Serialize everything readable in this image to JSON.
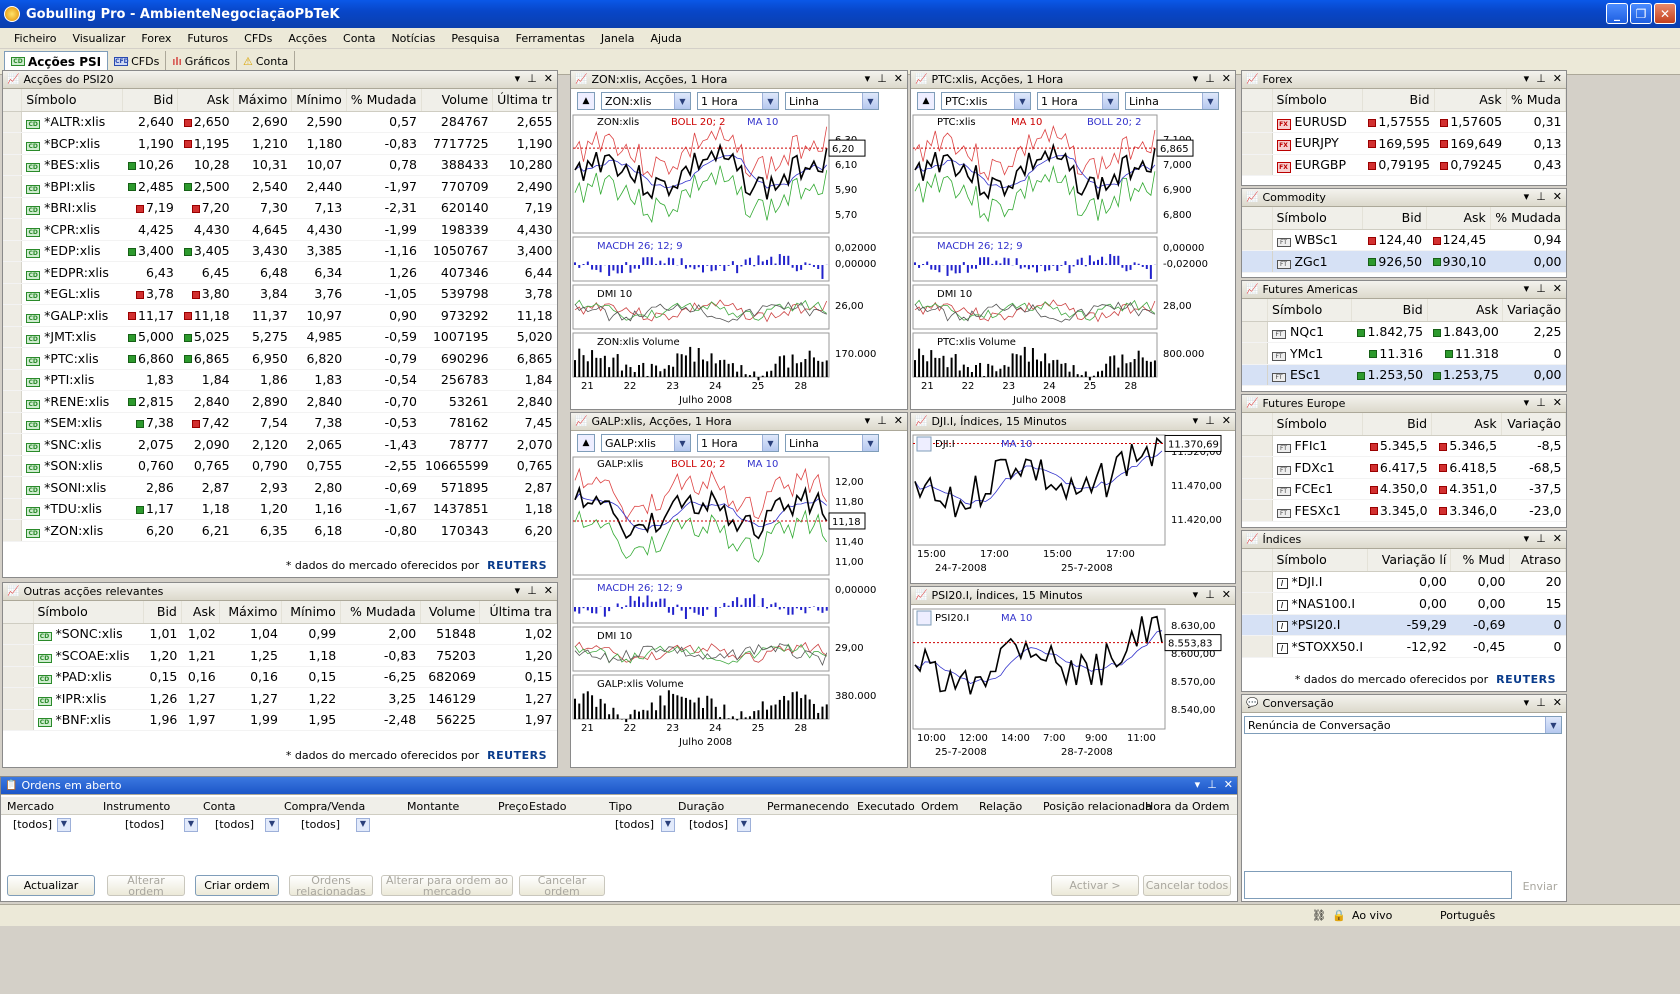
{
  "app": {
    "title": "Gobulling Pro - AmbienteNegociaçãoPbTeK"
  },
  "menu": [
    "Ficheiro",
    "Visualizar",
    "Forex",
    "Futuros",
    "CFDs",
    "Acções",
    "Conta",
    "Notícias",
    "Pesquisa",
    "Ferramentas",
    "Janela",
    "Ajuda"
  ],
  "toolbar": {
    "tabs": [
      "Acções PSI",
      "CFDs",
      "Gráficos",
      "Conta"
    ]
  },
  "psi20": {
    "title": "Acções do PSI20",
    "headers": [
      "Símbolo",
      "Bid",
      "Ask",
      "Máximo",
      "Mínimo",
      "% Mudada",
      "Volume",
      "Última tr"
    ],
    "rows": [
      [
        "*ALTR:xlis",
        "2,640",
        "2,650",
        "2,690",
        "2,590",
        "0,57",
        "284767",
        "2,655",
        "",
        "r"
      ],
      [
        "*BCP:xlis",
        "1,190",
        "1,195",
        "1,210",
        "1,180",
        "-0,83",
        "7717725",
        "1,190",
        "",
        "r"
      ],
      [
        "*BES:xlis",
        "10,26",
        "10,28",
        "10,31",
        "10,07",
        "0,78",
        "388433",
        "10,280",
        "g",
        ""
      ],
      [
        "*BPI:xlis",
        "2,485",
        "2,500",
        "2,540",
        "2,440",
        "-1,97",
        "770709",
        "2,490",
        "g",
        "g"
      ],
      [
        "*BRI:xlis",
        "7,19",
        "7,20",
        "7,30",
        "7,13",
        "-2,31",
        "620140",
        "7,19",
        "r",
        "r"
      ],
      [
        "*CPR:xlis",
        "4,425",
        "4,430",
        "4,645",
        "4,430",
        "-1,99",
        "198339",
        "4,430",
        "",
        ""
      ],
      [
        "*EDP:xlis",
        "3,400",
        "3,405",
        "3,430",
        "3,385",
        "-1,16",
        "1050767",
        "3,400",
        "g",
        "g"
      ],
      [
        "*EDPR:xlis",
        "6,43",
        "6,45",
        "6,48",
        "6,34",
        "1,26",
        "407346",
        "6,44",
        "",
        ""
      ],
      [
        "*EGL:xlis",
        "3,78",
        "3,80",
        "3,84",
        "3,76",
        "-1,05",
        "539798",
        "3,78",
        "r",
        "r"
      ],
      [
        "*GALP:xlis",
        "11,17",
        "11,18",
        "11,37",
        "10,97",
        "0,90",
        "973292",
        "11,18",
        "r",
        "r"
      ],
      [
        "*JMT:xlis",
        "5,000",
        "5,025",
        "5,275",
        "4,985",
        "-0,59",
        "1007195",
        "5,020",
        "g",
        "g"
      ],
      [
        "*PTC:xlis",
        "6,860",
        "6,865",
        "6,950",
        "6,820",
        "-0,79",
        "690296",
        "6,865",
        "g",
        "g"
      ],
      [
        "*PTI:xlis",
        "1,83",
        "1,84",
        "1,86",
        "1,83",
        "-0,54",
        "256783",
        "1,84",
        "",
        ""
      ],
      [
        "*RENE:xlis",
        "2,815",
        "2,840",
        "2,890",
        "2,840",
        "-0,70",
        "53261",
        "2,840",
        "g",
        ""
      ],
      [
        "*SEM:xlis",
        "7,38",
        "7,42",
        "7,54",
        "7,38",
        "-0,53",
        "78162",
        "7,45",
        "g",
        "r"
      ],
      [
        "*SNC:xlis",
        "2,075",
        "2,090",
        "2,120",
        "2,065",
        "-1,43",
        "78777",
        "2,070",
        "",
        ""
      ],
      [
        "*SON:xlis",
        "0,760",
        "0,765",
        "0,790",
        "0,755",
        "-2,55",
        "10665599",
        "0,765",
        "",
        ""
      ],
      [
        "*SONI:xlis",
        "2,86",
        "2,87",
        "2,93",
        "2,80",
        "-0,69",
        "571895",
        "2,87",
        "",
        ""
      ],
      [
        "*TDU:xlis",
        "1,17",
        "1,18",
        "1,20",
        "1,16",
        "-1,67",
        "1437851",
        "1,18",
        "g",
        ""
      ],
      [
        "*ZON:xlis",
        "6,20",
        "6,21",
        "6,35",
        "6,18",
        "-0,80",
        "170343",
        "6,20",
        "",
        ""
      ]
    ],
    "note": "* dados do mercado oferecidos por",
    "provider": "REUTERS"
  },
  "outras": {
    "title": "Outras acções relevantes",
    "headers": [
      "Símbolo",
      "Bid",
      "Ask",
      "Máximo",
      "Mínimo",
      "% Mudada",
      "Volume",
      "Última tra"
    ],
    "rows": [
      [
        "*SONC:xlis",
        "1,01",
        "1,02",
        "1,04",
        "0,99",
        "2,00",
        "51848",
        "1,02"
      ],
      [
        "*SCOAE:xlis",
        "1,20",
        "1,21",
        "1,25",
        "1,18",
        "-0,83",
        "75203",
        "1,20"
      ],
      [
        "*PAD:xlis",
        "0,15",
        "0,16",
        "0,16",
        "0,15",
        "-6,25",
        "682069",
        "0,15"
      ],
      [
        "*IPR:xlis",
        "1,26",
        "1,27",
        "1,27",
        "1,22",
        "3,25",
        "146129",
        "1,27"
      ],
      [
        "*BNF:xlis",
        "1,96",
        "1,97",
        "1,99",
        "1,95",
        "-2,48",
        "56225",
        "1,97"
      ]
    ],
    "note": "* dados do mercado oferecidos por",
    "provider": "REUTERS"
  },
  "charts": {
    "zon": {
      "title": "ZON:xlis, Acções, 1 Hora",
      "symbol": "ZON:xlis",
      "interval": "1 Hora",
      "style": "Linha",
      "legend1": "ZON:xlis",
      "legend2": "BOLL 20; 2",
      "legend3": "MA 10",
      "price_ticks": [
        "6,30",
        "6,10",
        "5,90",
        "5,70"
      ],
      "price_label": "6,20",
      "macd_label": "MACDH 26; 12; 9",
      "macd_ticks": [
        "0,02000",
        "0,00000"
      ],
      "dmi_label": "DMI 10",
      "dmi_tick": "26,00",
      "vol_label": "ZON:xlis Volume",
      "vol_tick": "170.000",
      "days": [
        "21",
        "22",
        "23",
        "24",
        "25",
        "28"
      ],
      "month": "Julho 2008"
    },
    "ptc": {
      "title": "PTC:xlis, Acções, 1 Hora",
      "symbol": "PTC:xlis",
      "interval": "1 Hora",
      "style": "Linha",
      "legend1": "PTC:xlis",
      "legend2": "MA 10",
      "legend3": "BOLL 20; 2",
      "price_ticks": [
        "7,100",
        "7,000",
        "6,900",
        "6,800"
      ],
      "price_label": "6,865",
      "macd_label": "MACDH 26; 12; 9",
      "macd_ticks": [
        "0,00000",
        "-0,02000"
      ],
      "dmi_label": "DMI 10",
      "dmi_tick": "28,00",
      "vol_label": "PTC:xlis Volume",
      "vol_tick": "800.000",
      "days": [
        "21",
        "22",
        "23",
        "24",
        "25",
        "28"
      ],
      "month": "Julho 2008"
    },
    "galp": {
      "title": "GALP:xlis, Acções, 1 Hora",
      "symbol": "GALP:xlis",
      "interval": "1 Hora",
      "style": "Linha",
      "legend1": "GALP:xlis",
      "legend2": "BOLL 20; 2",
      "legend3": "MA 10",
      "price_ticks": [
        "12,00",
        "11,80",
        "11,60",
        "11,40",
        "11,00"
      ],
      "price_label": "11,18",
      "macd_label": "MACDH 26; 12; 9",
      "macd_ticks": [
        "0,00000"
      ],
      "dmi_label": "DMI 10",
      "dmi_tick": "29,00",
      "vol_label": "GALP:xlis Volume",
      "vol_tick": "380.000",
      "days": [
        "21",
        "22",
        "23",
        "24",
        "25",
        "28"
      ],
      "month": "Julho 2008"
    },
    "dji": {
      "title": "DJI.I, Índices, 15 Minutos",
      "legend1": "DJI.I",
      "legend2": "MA 10",
      "price_ticks": [
        "11.520,00",
        "11.470,00",
        "11.420,00"
      ],
      "price_label": "11.370,69",
      "times": [
        "15:00",
        "17:00",
        "15:00",
        "17:00"
      ],
      "dates": [
        "24-7-2008",
        "25-7-2008"
      ]
    },
    "psi20i": {
      "title": "PSI20.I, Índices, 15 Minutos",
      "legend1": "PSI20.I",
      "legend2": "MA 10",
      "price_ticks": [
        "8.630,00",
        "8.600,00",
        "8.570,00",
        "8.540,00"
      ],
      "price_label": "8.553,83",
      "times": [
        "10:00",
        "12:00",
        "14:00",
        "7:00",
        "9:00",
        "11:00"
      ],
      "dates": [
        "25-7-2008",
        "28-7-2008"
      ]
    }
  },
  "forex": {
    "title": "Forex",
    "headers": [
      "Símbolo",
      "Bid",
      "Ask",
      "% Muda"
    ],
    "rows": [
      [
        "EURUSD",
        "1,57555",
        "1,57605",
        "0,31"
      ],
      [
        "EURJPY",
        "169,595",
        "169,649",
        "0,13"
      ],
      [
        "EURGBP",
        "0,79195",
        "0,79245",
        "0,43"
      ]
    ]
  },
  "commodity": {
    "title": "Commodity",
    "headers": [
      "Símbolo",
      "Bid",
      "Ask",
      "% Mudada"
    ],
    "rows": [
      [
        "WBSc1",
        "124,40",
        "124,45",
        "0,94"
      ],
      [
        "ZGc1",
        "926,50",
        "930,10",
        "0,00"
      ]
    ]
  },
  "fut_am": {
    "title": "Futures Americas",
    "headers": [
      "Símbolo",
      "Bid",
      "Ask",
      "Variação"
    ],
    "rows": [
      [
        "NQc1",
        "1.842,75",
        "1.843,00",
        "2,25"
      ],
      [
        "YMc1",
        "11.316",
        "11.318",
        "0"
      ],
      [
        "ESc1",
        "1.253,50",
        "1.253,75",
        "0,00"
      ]
    ]
  },
  "fut_eu": {
    "title": "Futures Europe",
    "headers": [
      "Símbolo",
      "Bid",
      "Ask",
      "Variação"
    ],
    "rows": [
      [
        "FFIc1",
        "5.345,5",
        "5.346,5",
        "-8,5"
      ],
      [
        "FDXc1",
        "6.417,5",
        "6.418,5",
        "-68,5"
      ],
      [
        "FCEc1",
        "4.350,0",
        "4.351,0",
        "-37,5"
      ],
      [
        "FESXc1",
        "3.345,0",
        "3.346,0",
        "-23,0"
      ]
    ]
  },
  "indices": {
    "title": "Índices",
    "headers": [
      "Símbolo",
      "Variação lí",
      "% Mud",
      "Atraso"
    ],
    "rows": [
      [
        "*DJI.I",
        "0,00",
        "0,00",
        "20"
      ],
      [
        "*NAS100.I",
        "0,00",
        "0,00",
        "15"
      ],
      [
        "*PSI20.I",
        "-59,29",
        "-0,69",
        "0"
      ],
      [
        "*STOXX50.I",
        "-12,92",
        "-0,45",
        "0"
      ]
    ],
    "note": "* dados do mercado oferecidos por",
    "provider": "REUTERS"
  },
  "conversa": {
    "title": "Conversação",
    "select": "Renúncia de Conversação",
    "send": "Enviar"
  },
  "orders": {
    "title": "Ordens em aberto",
    "headers": [
      "Mercado",
      "Instrumento",
      "Conta",
      "Compra/Venda",
      "Montante",
      "Preço",
      "Estado",
      "Tipo",
      "Duração",
      "Permanecendo",
      "Executado",
      "Ordem",
      "Relação",
      "Posição relacionada",
      "Hora da Ordem"
    ],
    "filter": "[todos]",
    "buttons": [
      "Actualizar",
      "Alterar ordem",
      "Criar ordem",
      "Ordens relacionadas",
      "Alterar para ordem ao mercado",
      "Cancelar ordem",
      "Activar >",
      "Cancelar todos"
    ]
  },
  "status": {
    "live": "Ao vivo",
    "lang": "Português"
  }
}
